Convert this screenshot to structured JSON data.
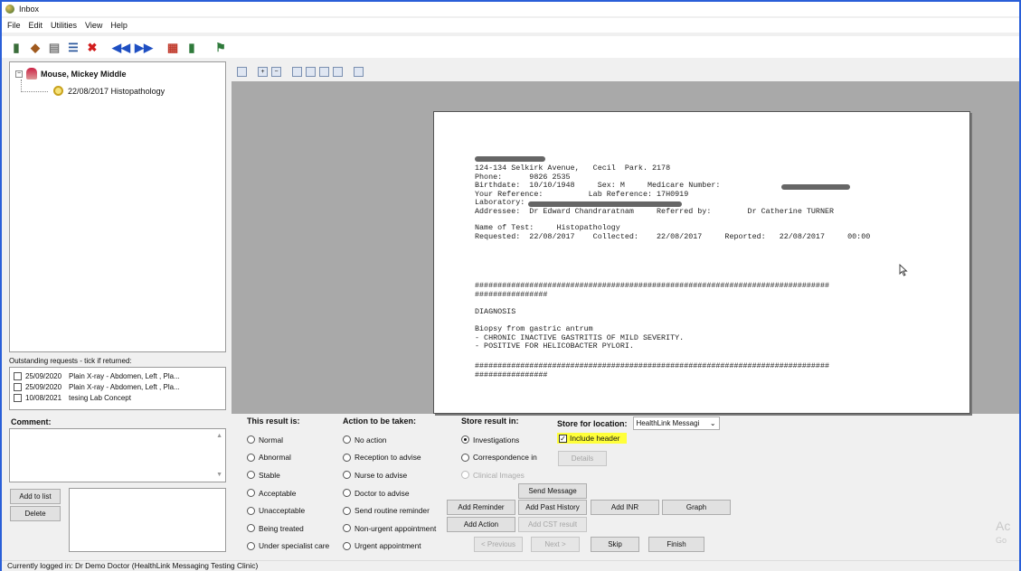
{
  "window": {
    "title": "Inbox"
  },
  "menu": [
    "File",
    "Edit",
    "Utilities",
    "View",
    "Help"
  ],
  "tree": {
    "patient": "Mouse, Mickey Middle",
    "result": "22/08/2017  Histopathology"
  },
  "outstanding": {
    "label": "Outstanding requests - tick if returned:",
    "rows": [
      {
        "date": "25/09/2020",
        "text": "Plain X-ray - Abdomen, Left , Pla..."
      },
      {
        "date": "25/09/2020",
        "text": "Plain X-ray - Abdomen, Left , Pla..."
      },
      {
        "date": "10/08/2021",
        "text": "tesing Lab Concept"
      }
    ]
  },
  "report": {
    "line_address": "124-134 Selkirk Avenue,   Cecil  Park. 2178",
    "line_phone": "Phone:      9826 2535",
    "line_birth": "Birthdate:  10/10/1948     Sex: M     Medicare Number:",
    "line_ref": "Your Reference:          Lab Reference: 17H0919",
    "line_lab": "Laboratory:",
    "line_addressee": "Addressee:  Dr Edward Chandraratnam     Referred by:        Dr Catherine TURNER",
    "line_test": "Name of Test:     Histopathology",
    "line_dates": "Requested:  22/08/2017    Collected:    22/08/2017     Reported:   22/08/2017     00:00",
    "hash1": "##############################################################################",
    "hash2": "################",
    "diagnosis": "DIAGNOSIS",
    "biopsy": "Biopsy from gastric antrum",
    "finding1": "- CHRONIC INACTIVE GASTRITIS OF MILD SEVERITY.",
    "finding2": "- POSITIVE FOR HELICOBACTER PYLORI.",
    "hash3": "##############################################################################",
    "hash4": "################"
  },
  "comment": {
    "label": "Comment:"
  },
  "buttons": {
    "add_to_list": "Add to list",
    "delete": "Delete",
    "details": "Details",
    "send_message": "Send Message",
    "add_reminder": "Add Reminder",
    "add_past_history": "Add Past History",
    "add_inr": "Add INR",
    "graph": "Graph",
    "add_action": "Add Action",
    "add_cst_result": "Add CST result",
    "previous": "< Previous",
    "next": "Next >",
    "skip": "Skip",
    "finish": "Finish"
  },
  "result_is": {
    "label": "This result is:",
    "options": [
      "Normal",
      "Abnormal",
      "Stable",
      "Acceptable",
      "Unacceptable",
      "Being treated",
      "Under specialist care"
    ]
  },
  "action": {
    "label": "Action to be taken:",
    "options": [
      "No action",
      "Reception to advise",
      "Nurse to advise",
      "Doctor to advise",
      "Send routine reminder",
      "Non-urgent appointment",
      "Urgent appointment"
    ]
  },
  "store_in": {
    "label": "Store result in:",
    "options": [
      "Investigations",
      "Correspondence in",
      "Clinical Images"
    ]
  },
  "location": {
    "label": "Store for location:",
    "value": "HealthLink Messagi"
  },
  "include_header": {
    "label": "Include header",
    "checked": true
  },
  "status": "Currently logged in:  Dr Demo Doctor (HealthLink Messaging Testing Clinic)",
  "watermark": {
    "line1": "Ac",
    "line2": "Go"
  },
  "colors": {
    "accent": "#2a5fd8",
    "highlight": "#ffff3a",
    "viewer_bg": "#a9a9a9"
  }
}
